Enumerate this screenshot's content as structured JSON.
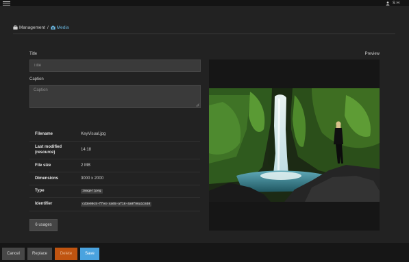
{
  "topbar": {
    "menu_icon": "hamburger-menu-icon",
    "user_icon": "user-icon",
    "user_initials": "S H"
  },
  "breadcrumb": {
    "items": [
      {
        "label": "Management",
        "icon": "briefcase-icon"
      },
      {
        "label": "Media",
        "icon": "camera-icon"
      }
    ],
    "separator": "/"
  },
  "form": {
    "title_label": "Title",
    "title_value": "",
    "title_placeholder": "Title",
    "caption_label": "Caption",
    "caption_value": "",
    "caption_placeholder": "Caption"
  },
  "metadata": {
    "filename": {
      "label": "Filename",
      "value": "KeyVisual.jpg"
    },
    "last_modified": {
      "label": "Last modified (resource)",
      "value": "14:18"
    },
    "file_size": {
      "label": "File size",
      "value": "2 MB"
    },
    "dimensions": {
      "label": "Dimensions",
      "value": "3000 x 2000"
    },
    "type": {
      "label": "Type",
      "value": "image/jpeg"
    },
    "identifier": {
      "label": "Identifier",
      "value": "cd3e00c5-ffe4-4a65-af16-4a0f96a1c840"
    }
  },
  "usages_button_label": "6 usages",
  "preview": {
    "label": "Preview",
    "image_alt": "Waterfall in a green gorge with a person standing on rocks"
  },
  "footer": {
    "cancel_label": "Cancel",
    "replace_label": "Replace",
    "delete_label": "Delete",
    "save_label": "Save"
  },
  "colors": {
    "accent": "#4aa3df",
    "danger": "#c05410",
    "background": "#222222",
    "topbar": "#141414"
  }
}
